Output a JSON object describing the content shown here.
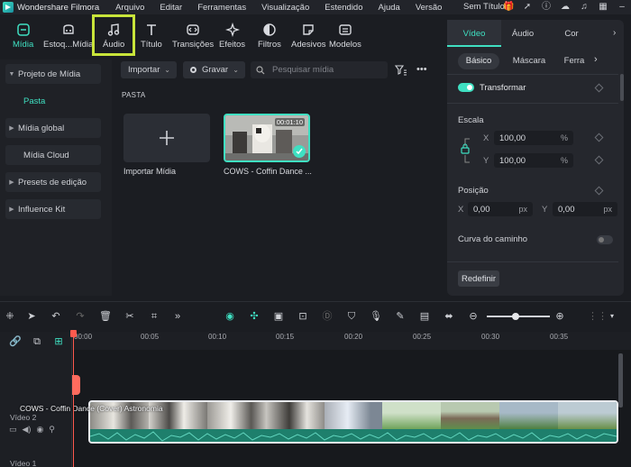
{
  "menubar": {
    "app_title": "Wondershare Filmora",
    "items": [
      "Arquivo",
      "Editar",
      "Ferramentas",
      "Visualização",
      "Estendido",
      "Ajuda",
      "Versão"
    ],
    "doc_title": "Sem Título"
  },
  "tooltabs": [
    {
      "label": "Mídia",
      "icon": "media-icon",
      "active": true
    },
    {
      "label": "Estoq...Mídia",
      "icon": "stock-media-icon"
    },
    {
      "label": "Áudio",
      "icon": "music-note-icon"
    },
    {
      "label": "Título",
      "icon": "title-t-icon"
    },
    {
      "label": "Transições",
      "icon": "transitions-icon"
    },
    {
      "label": "Efeitos",
      "icon": "effects-sparkle-icon"
    },
    {
      "label": "Filtros",
      "icon": "filters-icon"
    },
    {
      "label": "Adesivos",
      "icon": "stickers-icon"
    },
    {
      "label": "Modelos",
      "icon": "templates-icon"
    }
  ],
  "sidebar": {
    "items": [
      {
        "label": "Projeto de Mídia"
      },
      {
        "label": "Pasta"
      },
      {
        "label": "Mídia global"
      },
      {
        "label": "Mídia Cloud"
      },
      {
        "label": "Presets de edição"
      },
      {
        "label": "Influence Kit"
      }
    ]
  },
  "media": {
    "import_label": "Importar",
    "record_label": "Gravar",
    "search_placeholder": "Pesquisar mídia",
    "section": "PASTA",
    "import_tile_label": "Importar Mídia",
    "clip_label": "COWS - Coffin Dance ...",
    "clip_duration": "00:01:10"
  },
  "rpanel": {
    "tabs": [
      "Vídeo",
      "Áudio",
      "Cor"
    ],
    "subtabs": [
      "Básico",
      "Máscara",
      "Ferra"
    ],
    "transform_label": "Transformar",
    "scale_label": "Escala",
    "scale_x_axis": "X",
    "scale_x": "100,00",
    "scale_y_axis": "Y",
    "scale_y": "100,00",
    "scale_unit": "%",
    "position_label": "Posição",
    "pos_x_axis": "X",
    "pos_x": "0,00",
    "pos_y_axis": "Y",
    "pos_y": "0,00",
    "pos_unit": "px",
    "path_curve_label": "Curva do caminho",
    "reset_label": "Redefinir"
  },
  "timeline": {
    "ruler": [
      "00:00",
      "00:05",
      "00:10",
      "00:15",
      "00:20",
      "00:25",
      "00:30",
      "00:35"
    ],
    "track2_label": "Vídeo 2",
    "track1_label": "Vídeo 1",
    "clip_title": "COWS - Coffin Dance (Cover) Astronomia"
  },
  "colors": {
    "accent": "#3fe0c2",
    "highlight": "#c8e43a",
    "playhead": "#ff5a4e",
    "panel": "#25272d",
    "background": "#1b1d22"
  }
}
